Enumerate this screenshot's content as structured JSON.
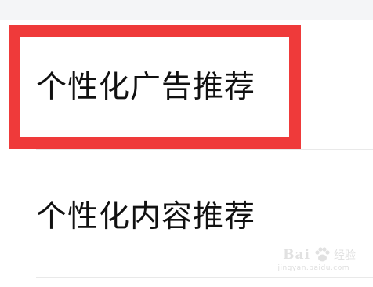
{
  "settings": {
    "items": [
      {
        "label": "个性化广告推荐"
      },
      {
        "label": "个性化内容推荐"
      }
    ]
  },
  "annotation": {
    "highlight_color": "#ef3a3a"
  },
  "watermark": {
    "brand": "Bai",
    "sub": "经验",
    "url": "jingyan.baidu.com"
  }
}
